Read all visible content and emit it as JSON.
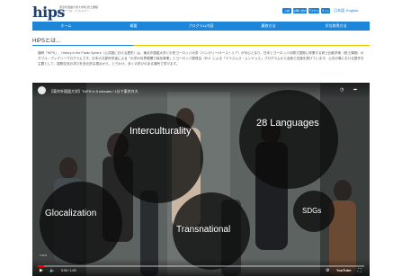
{
  "header": {
    "logo": "hips",
    "logo_sub_1": "東京外国語大学大学院 修士課程",
    "logo_sub_2": "グローバル・ヒストリー",
    "buttons": [
      "入試",
      "お問い合わせ",
      "アクセス",
      "サイト"
    ],
    "lang_ja": "日本語",
    "lang_en": "English",
    "accent_color": "#1d86d8"
  },
  "nav": {
    "items": [
      "ホーム",
      "概要",
      "プログラム内容",
      "履修方法",
      "学位取得方法"
    ]
  },
  "main": {
    "title": "HIPSとは...",
    "intro": "通称「HIPS」、History in the Public Sphere（公共圏における歴史）は、東京外国語大学と中央ヨーロッパ大学（ハンガリー/オーストリア）が中心となり、日本とヨーロッパの間で国際に修業する修士比較学術（修士課程）のダブル・ディグリープログラムです。日本の文部科学省による「大学の世界展開力強化事業」とヨーロッパ委員会（EU）による「エラスムス・ムンドゥス」プログラムから全面で支援を受けています。公共の場における歴史を主題として、国際交流の学びを多元的な視点から、とりわけ、多くの学びのある場所で学びます。"
  },
  "video": {
    "title": "【東京外国語大学】TUFS in 5 minutes / 1分で東京外大",
    "bubbles": {
      "interculturality": "Interculturality",
      "languages": "28 Languages",
      "glocalization": "Glocalization",
      "transnational": "Transnational",
      "sdgs": "SDGs"
    },
    "time": "0:00 / 1:00",
    "progress": 0.02,
    "youtube": "YouTube",
    "channel_label": "TUFS"
  }
}
